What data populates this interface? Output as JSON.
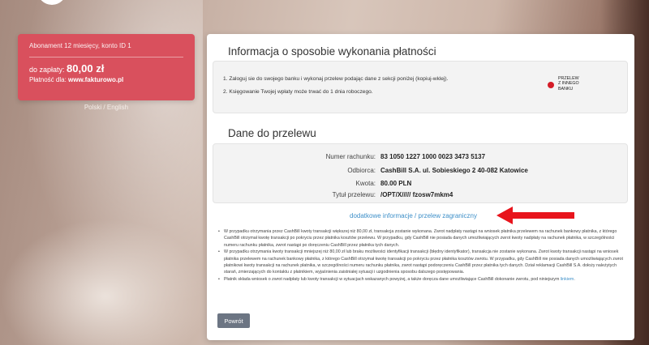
{
  "summary": {
    "subscription": "Abonament 12 miesięcy, konto ID 1",
    "amount_label": "do zapłaty:",
    "amount": "80,00 zł",
    "for_label": "Płatność dla:",
    "for_value": "www.fakturowo.pl"
  },
  "lang": {
    "polish": "Polski",
    "separator": "/",
    "english": "English"
  },
  "info": {
    "title": "Informacja o sposobie wykonania płatności",
    "steps": [
      "1. Zaloguj sie do swojego banku i wykonaj przelew podając dane z sekcji poniżej (kopiuj-wklej).",
      "2. Księgowanie Twojej wpłaty może trwać do 1 dnia roboczego."
    ],
    "method_label": [
      "PRZELEW",
      "Z INNEGO",
      "BANKU"
    ],
    "method_dot_color": "#d41c27"
  },
  "transfer": {
    "title": "Dane do przelewu",
    "rows": [
      {
        "label": "Numer rachunku:",
        "value": "83 1050 1227 1000 0023 3473 5137"
      },
      {
        "label": "Odbiorca:",
        "value": "CashBill S.A. ul. Sobieskiego 2 40-082 Katowice"
      },
      {
        "label": "Kwota:",
        "value": "80.00 PLN"
      },
      {
        "label": "Tytuł przelewu:",
        "value": "/OPT/X///// fzosw7mkm4"
      }
    ],
    "extra_link": "dodatkowe informacje / przelew zagraniczny"
  },
  "notes": {
    "items": [
      "W przypadku otrzymania przez CashBill kwoty transakcji większej niż 80,00 zł, transakcja zostanie wykonana. Zwrot nadpłaty nastąpi na wniosek płatnika przelewem na rachunek bankowy płatnika, z którego CashBill otrzymał kwotę transakcji po pokryciu przez płatnika kosztów przelewu. W przypadku, gdy CashBill nie posiada danych umożliwiających zwrot kwoty nadpłaty na rachunek płatnika, w szczególności numeru rachunku płatnika, zwrot nastąpi po doręczeniu CashBill przez płatnika tych danych.",
      "W przypadku otrzymania kwoty transakcji mniejszej niż 80,00 zł lub braku możliwości identyfikacji transakcji (błędny identyfikator), transakcja nie zostanie wykonana. Zwrot kwoty transakcji nastąpi na wniosek płatnika przelewem na rachunek bankowy płatnika, z którego CashBill otrzymał kwotę transakcji po pokryciu przez płatnika kosztów zwrotu. W przypadku, gdy CashBill nie posiada danych umożliwiających zwrot płatnikowi kwoty transakcji na rachunek płatnika, w szczególności numeru rachunku płatnika, zwrot nastąpi podoręczeniu CashBill przez płatnika tych danych. Dział reklamacji CashBill S.A. dołoży należytych starań, zmierzających do kontaktu z płatnikiem, wyjaśnienia zaistniałej sytuacji i uzgodnienia sposobu dalszego postępowania."
    ],
    "last_prefix": "Płatnik składa wniosek o zwrot nadpłaty lub kwoty transakcji w sytuacjach wskazanych powyżej, a także doręcza dane umożliwiające CashBill dokonanie zwrotu, pod niniejszym ",
    "last_link": "linkiem",
    "last_suffix": "."
  },
  "back_button": "Powrót",
  "colors": {
    "summary_bg": "#d9505d",
    "link": "#3d8fc8",
    "arrow": "#e8141c",
    "button": "#6c7583"
  }
}
